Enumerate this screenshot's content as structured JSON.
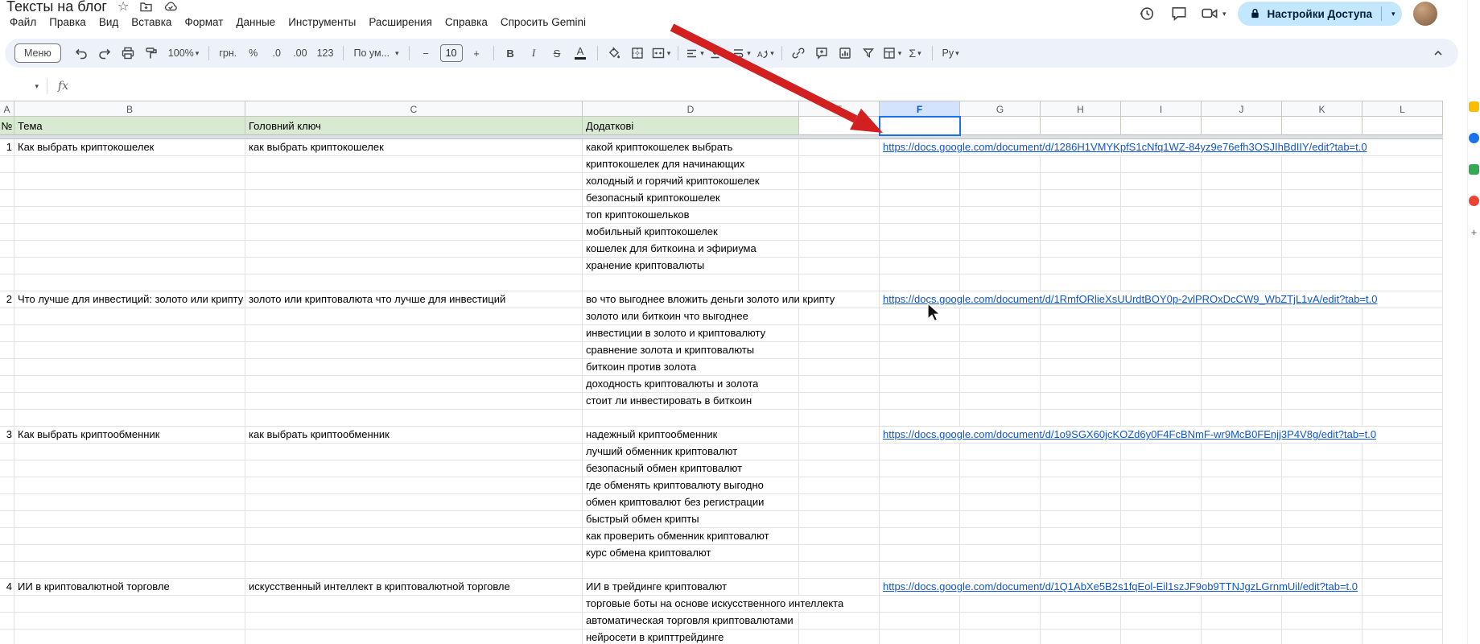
{
  "document": {
    "title": "Тексты на блог"
  },
  "menu": {
    "items": [
      "Файл",
      "Правка",
      "Вид",
      "Вставка",
      "Формат",
      "Данные",
      "Инструменты",
      "Расширения",
      "Справка",
      "Спросить Gemini"
    ]
  },
  "top_right": {
    "share_label": "Настройки Доступа"
  },
  "toolbar": {
    "menus": "Меню",
    "zoom": "100%",
    "currency": "грн.",
    "percent": "%",
    "decrease_decimal": ".0",
    "increase_decimal": ".00",
    "more_formats": "123",
    "font": "По ум...",
    "font_size": "10",
    "bold": "B",
    "italic": "I",
    "strikethrough": "S",
    "text_color": "A",
    "functions": "Σ",
    "input_tools": "Ру"
  },
  "formula_bar": {
    "name_box": "",
    "fx": "fx"
  },
  "spreadsheet": {
    "selected_column": "F",
    "column_letters": [
      "A",
      "B",
      "C",
      "D",
      "E",
      "F",
      "G",
      "H",
      "I",
      "J",
      "K",
      "L"
    ],
    "header_row": {
      "A": "№",
      "B": "Тема",
      "C": "Головний ключ",
      "D": "Додаткові"
    },
    "rows": [
      {
        "a": "1",
        "b": "Как выбрать криптокошелек",
        "c": "как выбрать криптокошелек",
        "d": "какой криптокошелек выбрать",
        "f": "https://docs.google.com/document/d/1286H1VMYKpfS1cNfq1WZ-84yz9e76efh3OSJIhBdIIY/edit?tab=t.0"
      },
      {
        "d": "криптокошелек для начинающих"
      },
      {
        "d": "холодный и горячий криптокошелек"
      },
      {
        "d": "безопасный криптокошелек"
      },
      {
        "d": "топ криптокошельков"
      },
      {
        "d": "мобильный криптокошелек"
      },
      {
        "d": "кошелек для биткоина и эфириума"
      },
      {
        "d": "хранение криптовалюты"
      },
      {},
      {
        "a": "2",
        "b": "Что лучше для инвестиций: золото или крипту",
        "c": "золото или криптовалюта что лучше для инвестиций",
        "d": "во что выгоднее вложить деньги золото или крипту",
        "f": "https://docs.google.com/document/d/1RmfORlieXsUUrdtBOY0p-2vlPROxDcCW9_WbZTjL1vA/edit?tab=t.0"
      },
      {
        "d": "золото или биткоин что выгоднее"
      },
      {
        "d": "инвестиции в золото и криптовалюту"
      },
      {
        "d": "сравнение золота и криптовалюты"
      },
      {
        "d": "биткоин против золота"
      },
      {
        "d": "доходность криптовалюты и золота"
      },
      {
        "d": "стоит ли инвестировать в биткоин"
      },
      {},
      {
        "a": "3",
        "b": "Как выбрать криптообменник",
        "c": "как выбрать криптообменник",
        "d": "надежный криптообменник",
        "f": "https://docs.google.com/document/d/1o9SGX60jcKOZd6y0F4FcBNmF-wr9McB0FEnjj3P4V8g/edit?tab=t.0"
      },
      {
        "d": "лучший обменник криптовалют"
      },
      {
        "d": "безопасный обмен криптовалют"
      },
      {
        "d": "где обменять криптовалюту выгодно"
      },
      {
        "d": "обмен криптовалют без регистрации"
      },
      {
        "d": "быстрый обмен крипты"
      },
      {
        "d": "как проверить обменник криптовалют"
      },
      {
        "d": "курс обмена криптовалют"
      },
      {},
      {
        "a": "4",
        "b": "ИИ в криптовалютной торговле",
        "c": "искусственный интеллект в криптовалютной торговле",
        "d": "ИИ в трейдинге криптовалют",
        "f": "https://docs.google.com/document/d/1Q1AbXe5B2s1fqEol-Eil1szJF9ob9TTNJgzLGrnmUil/edit?tab=t.0"
      },
      {
        "d": "торговые боты на основе искусственного интеллекта"
      },
      {
        "d": "автоматическая торговля криптовалютами"
      },
      {
        "d": "нейросети в крипттрейдинге"
      }
    ]
  },
  "colors": {
    "header_green": "#d9ead3",
    "selected_column_header": "#d3e3fd",
    "link": "#1155cc",
    "share_button": "#c2e7ff",
    "annotation_arrow": "#d21f1f"
  }
}
